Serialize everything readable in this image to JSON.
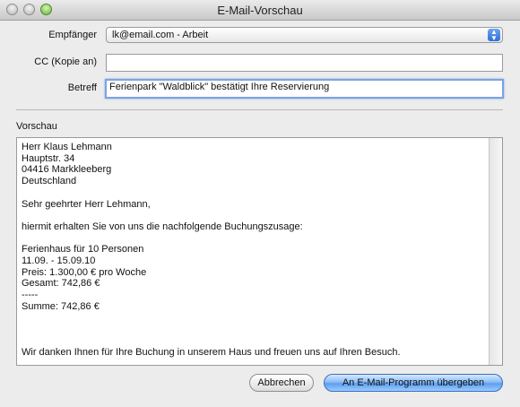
{
  "window": {
    "title": "E-Mail-Vorschau"
  },
  "form": {
    "recipient_label": "Empfänger",
    "recipient_value": "lk@email.com - Arbeit",
    "cc_label": "CC (Kopie an)",
    "cc_value": "",
    "subject_label": "Betreff",
    "subject_value": "Ferienpark \"Waldblick\" bestätigt Ihre Reservierung"
  },
  "preview": {
    "label": "Vorschau",
    "lines": [
      "Herr Klaus Lehmann",
      "Hauptstr. 34",
      "04416 Markkleeberg",
      "Deutschland",
      "",
      "Sehr geehrter Herr Lehmann,",
      "",
      "hiermit erhalten Sie von uns die nachfolgende Buchungszusage:",
      "",
      "Ferienhaus für 10 Personen",
      "11.09. - 15.09.10",
      "Preis: 1.300,00 € pro Woche",
      "Gesamt: 742,86 €",
      "-----",
      "Summe: 742,86 €",
      "",
      "",
      "",
      "Wir danken Ihnen für Ihre Buchung in unserem Haus und freuen uns auf Ihren Besuch."
    ]
  },
  "buttons": {
    "cancel": "Abbrechen",
    "submit": "An E-Mail-Programm übergeben"
  }
}
